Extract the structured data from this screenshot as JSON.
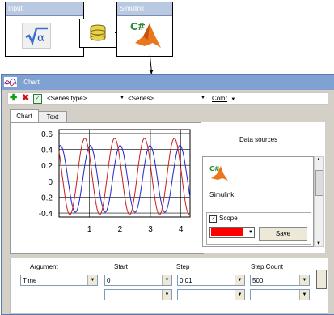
{
  "diagram": {
    "input_block": {
      "title": "Input",
      "icon": "sqrt-alpha-icon"
    },
    "database_icon": "database-icon",
    "simulink_block": {
      "title": "Simulink",
      "icon": "csharp-matlab-icon"
    }
  },
  "window": {
    "title": "Chart",
    "icon": "chart-icon"
  },
  "toolbar": {
    "add_icon": "plus-icon",
    "delete_icon": "delete-icon",
    "properties_icon": "properties-icon",
    "series_type": "<Series type>",
    "series": "<Series>",
    "color_label": "Color"
  },
  "tabs": [
    {
      "label": "Chart"
    },
    {
      "label": "Text"
    }
  ],
  "chart_data": {
    "type": "line",
    "title": "",
    "xlabel": "",
    "ylabel": "",
    "xlim": [
      0,
      4.3
    ],
    "ylim": [
      -0.45,
      0.65
    ],
    "x_ticks": [
      "1",
      "2",
      "3",
      "4"
    ],
    "x_tick_values": [
      1,
      2,
      3,
      4
    ],
    "y_ticks": [
      "0.6",
      "0.4",
      "0.2",
      "0",
      "-0.2",
      "-0.4"
    ],
    "y_tick_values": [
      0.6,
      0.4,
      0.2,
      0,
      -0.2,
      -0.4
    ],
    "grid": true,
    "series": [
      {
        "color": "#2222c8",
        "amplitude": 0.42,
        "period": 0.98,
        "phase": -0.2,
        "offset": 0.03
      },
      {
        "color": "#c81e1e",
        "amplitude": 0.48,
        "period": 0.98,
        "phase": 0.6,
        "offset": 0.06
      }
    ]
  },
  "data_sources": {
    "heading": "Data sources",
    "source_label": "Simulink",
    "source_icon": "csharp-matlab-icon",
    "scope_label": "Scope",
    "scope_checked": true,
    "scope_color": "#ff0000",
    "save_label": "Save"
  },
  "bottom": {
    "headers": {
      "argument": "Argument",
      "start": "Start",
      "step": "Step",
      "step_count": "Step Count"
    },
    "argument_value": "Time",
    "start_value": "0",
    "step_value": "0.01",
    "step_count_value": "500"
  }
}
